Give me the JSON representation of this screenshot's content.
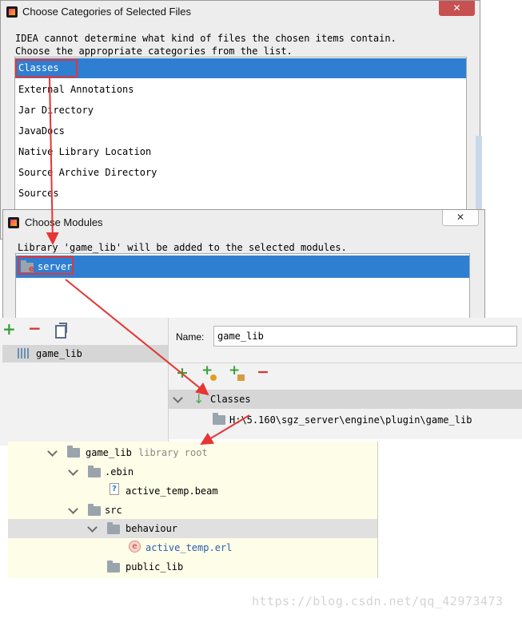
{
  "dialog1": {
    "title": "Choose Categories of Selected Files",
    "close": "✕",
    "message_line1": "IDEA cannot determine what kind of files the chosen items contain.",
    "message_line2": "Choose the appropriate categories from the list.",
    "items": [
      "Classes",
      "External Annotations",
      "Jar Directory",
      "JavaDocs",
      "Native Library Location",
      "Source Archive Directory",
      "Sources"
    ],
    "selected_index": 0
  },
  "dialog2": {
    "title": "Choose Modules",
    "close": "✕",
    "message": "Library 'game_lib' will be added to the selected modules.",
    "module": "server",
    "module_badge": "e"
  },
  "libraries": {
    "add": "+",
    "remove": "−",
    "item": "game_lib"
  },
  "library_detail": {
    "name_label": "Name:",
    "name_value": "game_lib",
    "section": "Classes",
    "path": "H:\\5.160\\sgz_server\\engine\\plugin\\game_lib",
    "add": "+",
    "remove": "−"
  },
  "project_tree": {
    "root": "game_lib",
    "root_hint": "library root",
    "ebin": ".ebin",
    "beam_file": "active_temp.beam",
    "src": "src",
    "behaviour": "behaviour",
    "erl_file": "active_temp.erl",
    "erl_badge": "e",
    "public_lib": "public_lib"
  },
  "watermark": "https://blog.csdn.net/qq_42973473",
  "colors": {
    "selection": "#2e7fd1",
    "annotation": "#e53535",
    "tree_bg": "#fdfde8",
    "tree_selected": "#e0e0e0"
  }
}
